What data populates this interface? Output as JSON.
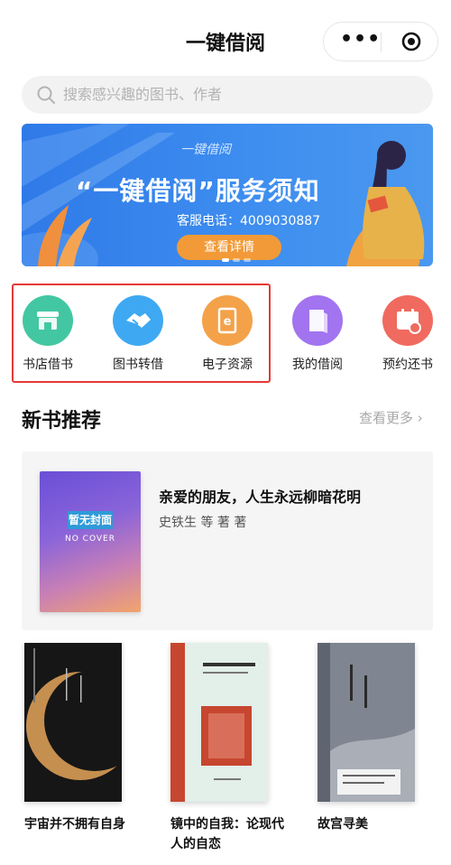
{
  "header": {
    "title": "一键借阅"
  },
  "search": {
    "placeholder": "搜索感兴趣的图书、作者"
  },
  "banner": {
    "logo": "一键借阅",
    "headline": "“一键借阅”服务须知",
    "phone": "客服电话：4009030887",
    "cta": "查看详情"
  },
  "shortcuts": [
    {
      "label": "书店借书",
      "icon": "store-icon",
      "color": "#43c7a2"
    },
    {
      "label": "图书转借",
      "icon": "handshake-icon",
      "color": "#3ea9f2"
    },
    {
      "label": "电子资源",
      "icon": "ebook-icon",
      "color": "#f3a24a"
    },
    {
      "label": "我的借阅",
      "icon": "book-icon",
      "color": "#a274f0"
    },
    {
      "label": "预约还书",
      "icon": "calendar-icon",
      "color": "#f06a5f"
    }
  ],
  "section": {
    "title": "新书推荐",
    "more": "查看更多 ›"
  },
  "featured": {
    "cover_text": "暂无封面",
    "cover_subtext": "NO COVER",
    "title": "亲爱的朋友，人生永远柳暗花明",
    "author": "史铁生 等 著 著"
  },
  "books": [
    {
      "title": "宇宙并不拥有自身"
    },
    {
      "title": "镜中的自我：论现代人的自恋"
    },
    {
      "title": "故宫寻美"
    }
  ]
}
